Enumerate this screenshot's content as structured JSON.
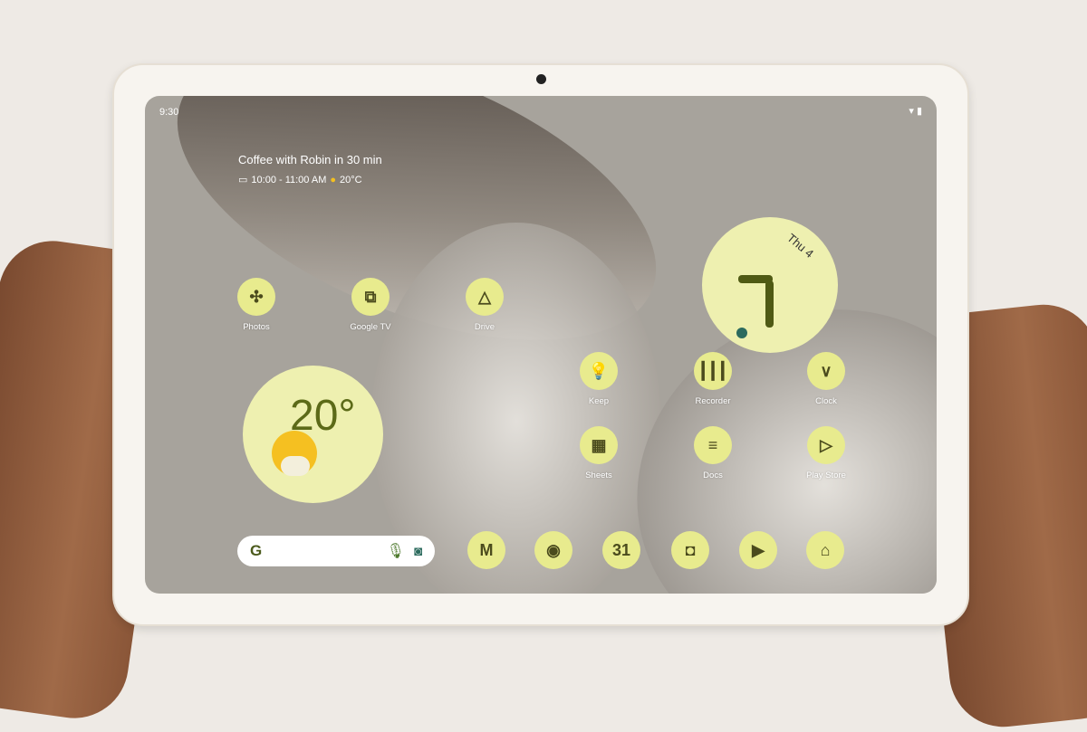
{
  "status_bar": {
    "time": "9:30",
    "wifi_icon": "wifi-icon",
    "battery_icon": "battery-icon"
  },
  "at_a_glance": {
    "event": "Coffee with Robin in 30 min",
    "time_range": "10:00 - 11:00 AM",
    "temperature": "20°C"
  },
  "clock_widget": {
    "date": "Thu 4"
  },
  "weather_widget": {
    "temperature": "20°"
  },
  "apps": [
    {
      "label": "Photos",
      "glyph": "✣"
    },
    {
      "label": "Google TV",
      "glyph": "⧉"
    },
    {
      "label": "Drive",
      "glyph": "△"
    },
    {
      "label": "Keep",
      "glyph": "💡"
    },
    {
      "label": "Recorder",
      "glyph": "┃┃┃"
    },
    {
      "label": "Clock",
      "glyph": "∨"
    },
    {
      "label": "Sheets",
      "glyph": "▦"
    },
    {
      "label": "Docs",
      "glyph": "≡"
    },
    {
      "label": "Play Store",
      "glyph": "▷"
    }
  ],
  "dock": [
    {
      "name": "gmail",
      "glyph": "M"
    },
    {
      "name": "chrome",
      "glyph": "◉"
    },
    {
      "name": "calendar",
      "glyph": "31"
    },
    {
      "name": "camera",
      "glyph": "◘"
    },
    {
      "name": "youtube",
      "glyph": "▶"
    },
    {
      "name": "home",
      "glyph": "⌂"
    }
  ],
  "search": {
    "logo": "G",
    "mic_icon": "mic-icon",
    "lens_icon": "lens-icon"
  },
  "colors": {
    "icon_bg": "#e8eb8e",
    "icon_fg": "#4b4b1d",
    "wallpaper": "#a7a39c",
    "clock_hand": "#4f5a14",
    "clock_dot": "#2c6b5e"
  }
}
